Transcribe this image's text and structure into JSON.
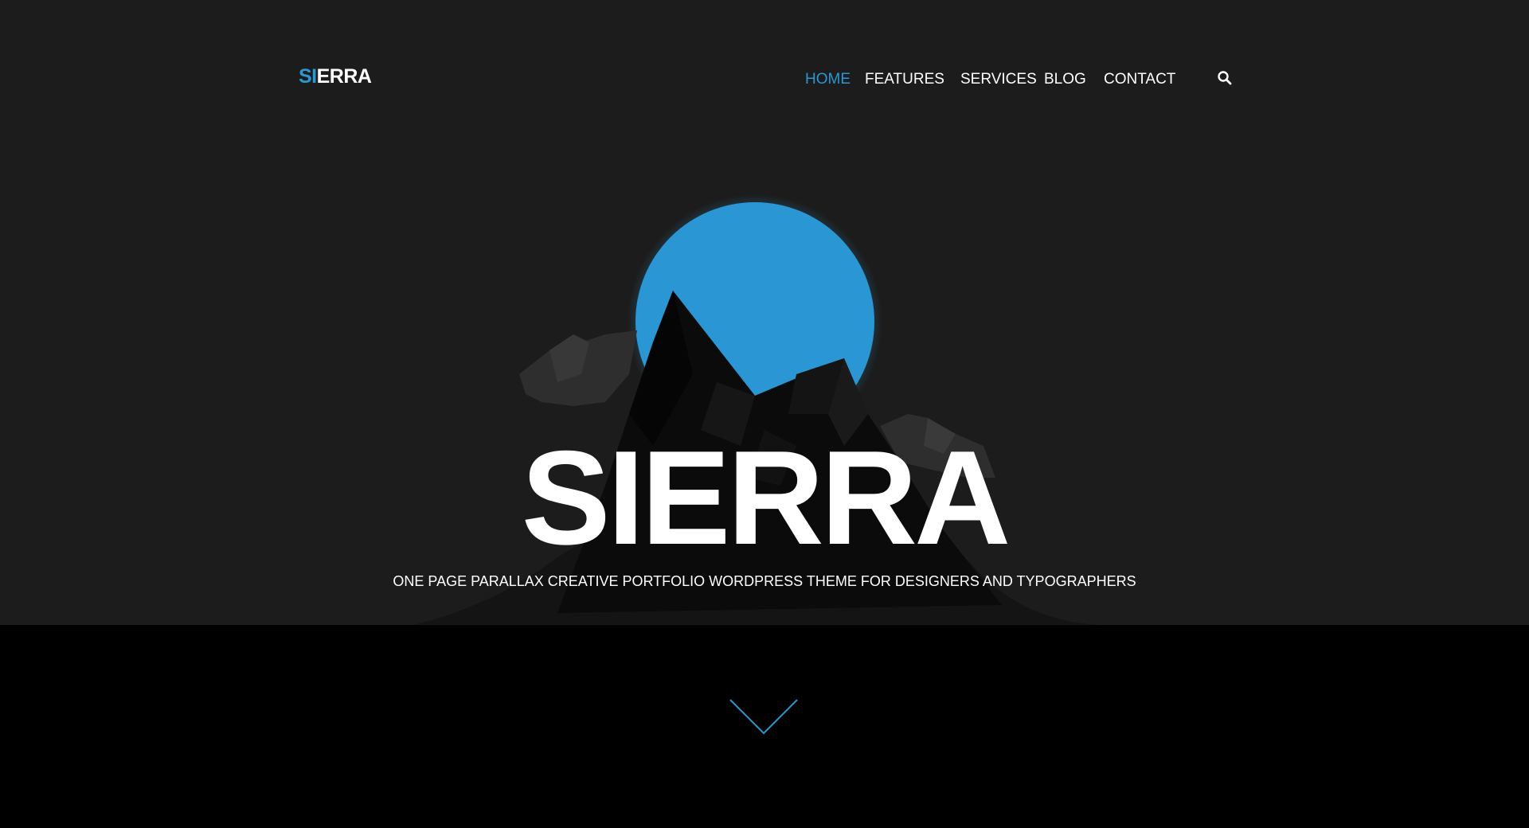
{
  "header": {
    "logo_accent": "SI",
    "logo_rest": "ERRA"
  },
  "nav": {
    "items": [
      {
        "label": "HOME",
        "active": true
      },
      {
        "label": "FEATURES",
        "active": false
      },
      {
        "label": "SERVICES",
        "active": false
      },
      {
        "label": "BLOG",
        "active": false
      },
      {
        "label": "CONTACT",
        "active": false
      }
    ],
    "search_icon": "search-icon"
  },
  "hero": {
    "title": "SIERRA",
    "subtitle": "ONE PAGE PARALLAX CREATIVE PORTFOLIO WORDPRESS THEME FOR DESIGNERS AND TYPOGRAPHERS",
    "scroll_icon": "chevron-down-icon"
  },
  "colors": {
    "accent": "#2a96d3",
    "hero_background": "#1c1c1c",
    "lower_background": "#000000",
    "text": "#ffffff"
  }
}
